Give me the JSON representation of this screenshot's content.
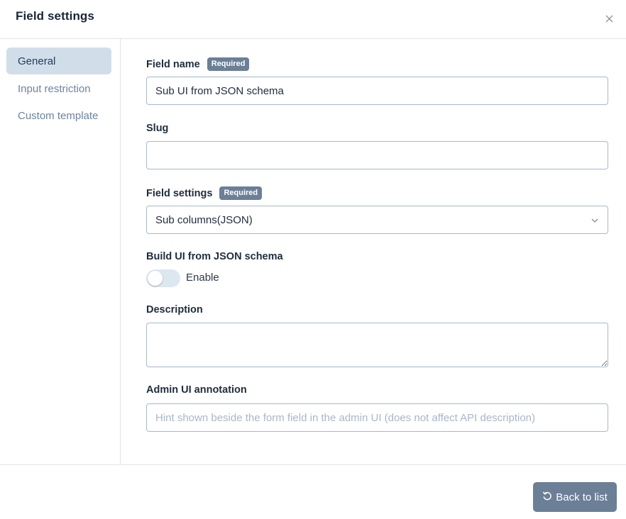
{
  "header": {
    "title": "Field settings",
    "close_icon": "close-icon"
  },
  "sidebar": {
    "items": [
      {
        "label": "General",
        "active": true
      },
      {
        "label": "Input restriction",
        "active": false
      },
      {
        "label": "Custom template",
        "active": false
      }
    ]
  },
  "form": {
    "field_name": {
      "label": "Field name",
      "badge": "Required",
      "value": "Sub UI from JSON schema"
    },
    "slug": {
      "label": "Slug",
      "value": ""
    },
    "field_settings": {
      "label": "Field settings",
      "badge": "Required",
      "selected": "Sub columns(JSON)"
    },
    "build_ui": {
      "label": "Build UI from JSON schema",
      "toggle_label": "Enable",
      "enabled": false
    },
    "description": {
      "label": "Description",
      "value": ""
    },
    "admin_annotation": {
      "label": "Admin UI annotation",
      "placeholder": "Hint shown beside the form field in the admin UI (does not affect API description)"
    }
  },
  "footer": {
    "back_label": "Back to list",
    "back_icon": "undo-icon"
  },
  "colors": {
    "accent": "#6b7f96",
    "active_nav_bg": "#d1deea",
    "border": "#a6b8cc"
  }
}
